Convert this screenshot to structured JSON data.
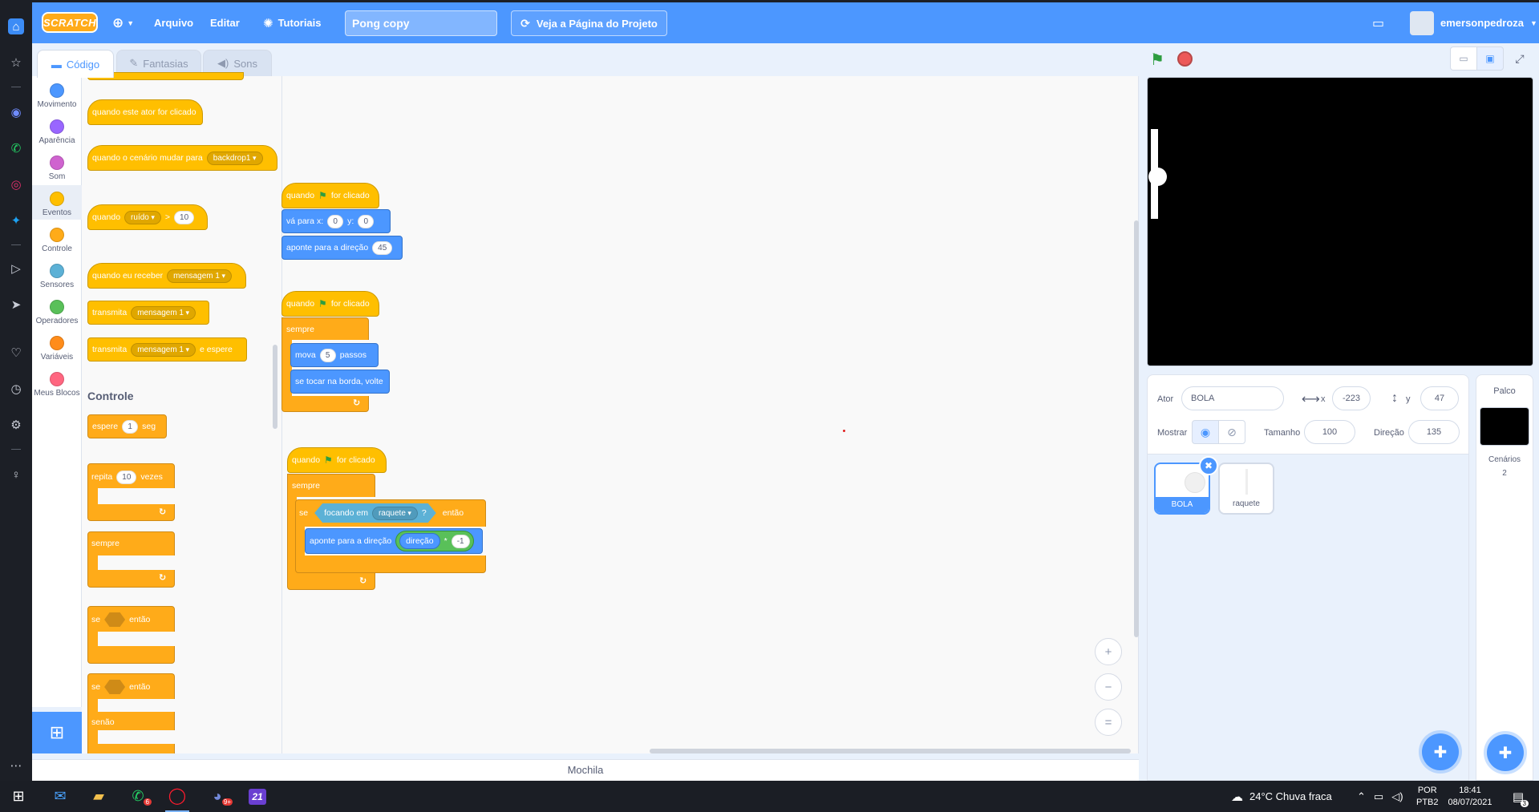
{
  "opera_sidebar": {
    "icons": [
      "home-icon",
      "speed-dial-icon",
      "messenger-icon",
      "whatsapp-icon",
      "instagram-icon",
      "twitter-icon",
      "player-icon",
      "send-icon",
      "heart-icon",
      "history-icon",
      "settings-icon",
      "lightbulb-icon",
      "more-icon"
    ]
  },
  "menu": {
    "logo": "SCRATCH",
    "file": "Arquivo",
    "edit": "Editar",
    "tutorials": "Tutoriais",
    "project_title": "Pong copy",
    "see_project": "Veja a Página do Projeto",
    "username": "emersonpedroza"
  },
  "tabs": {
    "code": "Código",
    "costumes": "Fantasias",
    "sounds": "Sons"
  },
  "categories": [
    {
      "label": "Movimento",
      "color": "#4c97ff"
    },
    {
      "label": "Aparência",
      "color": "#9966ff"
    },
    {
      "label": "Som",
      "color": "#cf63cf"
    },
    {
      "label": "Eventos",
      "color": "#ffbf00"
    },
    {
      "label": "Controle",
      "color": "#ffab19"
    },
    {
      "label": "Sensores",
      "color": "#5cb1d6"
    },
    {
      "label": "Operadores",
      "color": "#59c059"
    },
    {
      "label": "Variáveis",
      "color": "#ff8c1a"
    },
    {
      "label": "Meus Blocos",
      "color": "#ff6680"
    }
  ],
  "palette": {
    "when_sprite_clicked": "quando este ator for clicado",
    "when_backdrop_switches": "quando o cenário mudar para",
    "backdrop_option": "backdrop1",
    "when_greater_prefix": "quando",
    "loudness_option": "ruído",
    "greater_sign": ">",
    "greater_value": "10",
    "when_receive": "quando eu receber",
    "message_option": "mensagem 1",
    "broadcast": "transmita",
    "broadcast_wait_suffix": "e espere",
    "section_control": "Controle",
    "wait": "espere",
    "wait_value": "1",
    "wait_unit": "seg",
    "repeat": "repita",
    "repeat_value": "10",
    "repeat_suffix": "vezes",
    "forever": "sempre",
    "if": "se",
    "then": "então",
    "else": "senão"
  },
  "scripts": {
    "when": "quando",
    "flag_clicked": "for clicado",
    "goto_x": "vá para x:",
    "x_value": "0",
    "goto_y": "y:",
    "y_value": "0",
    "point_direction": "aponte para a direção",
    "direction_value": "45",
    "forever": "sempre",
    "move": "mova",
    "move_value": "5",
    "move_unit": "passos",
    "bounce": "se tocar na borda, volte",
    "if": "se",
    "touching": "focando em",
    "touching_target": "raquete",
    "question": "?",
    "then": "então",
    "direction_reporter": "direção",
    "multiply": "*",
    "multiply_value": "-1"
  },
  "zoom": {
    "in": "+",
    "out": "−",
    "reset": "="
  },
  "backpack": "Mochila",
  "sprite_info": {
    "sprite_label": "Ator",
    "sprite_name": "BOLA",
    "x_label": "x",
    "x_value": "-223",
    "y_label": "y",
    "y_value": "47",
    "show_label": "Mostrar",
    "size_label": "Tamanho",
    "size_value": "100",
    "direction_label": "Direção",
    "direction_value": "135"
  },
  "sprites": [
    {
      "name": "BOLA",
      "selected": true
    },
    {
      "name": "raquete",
      "selected": false
    }
  ],
  "stage_panel": {
    "title": "Palco",
    "backdrops_label": "Cenários",
    "backdrops_count": "2"
  },
  "taskbar": {
    "weather": "24°C  Chuva fraca",
    "lang_top": "POR",
    "lang_bottom": "PTB2",
    "time": "18:41",
    "date": "08/07/2021",
    "whatsapp_badge": "6",
    "discord_badge": "9+",
    "notifications_badge": "3",
    "app21": "21"
  }
}
